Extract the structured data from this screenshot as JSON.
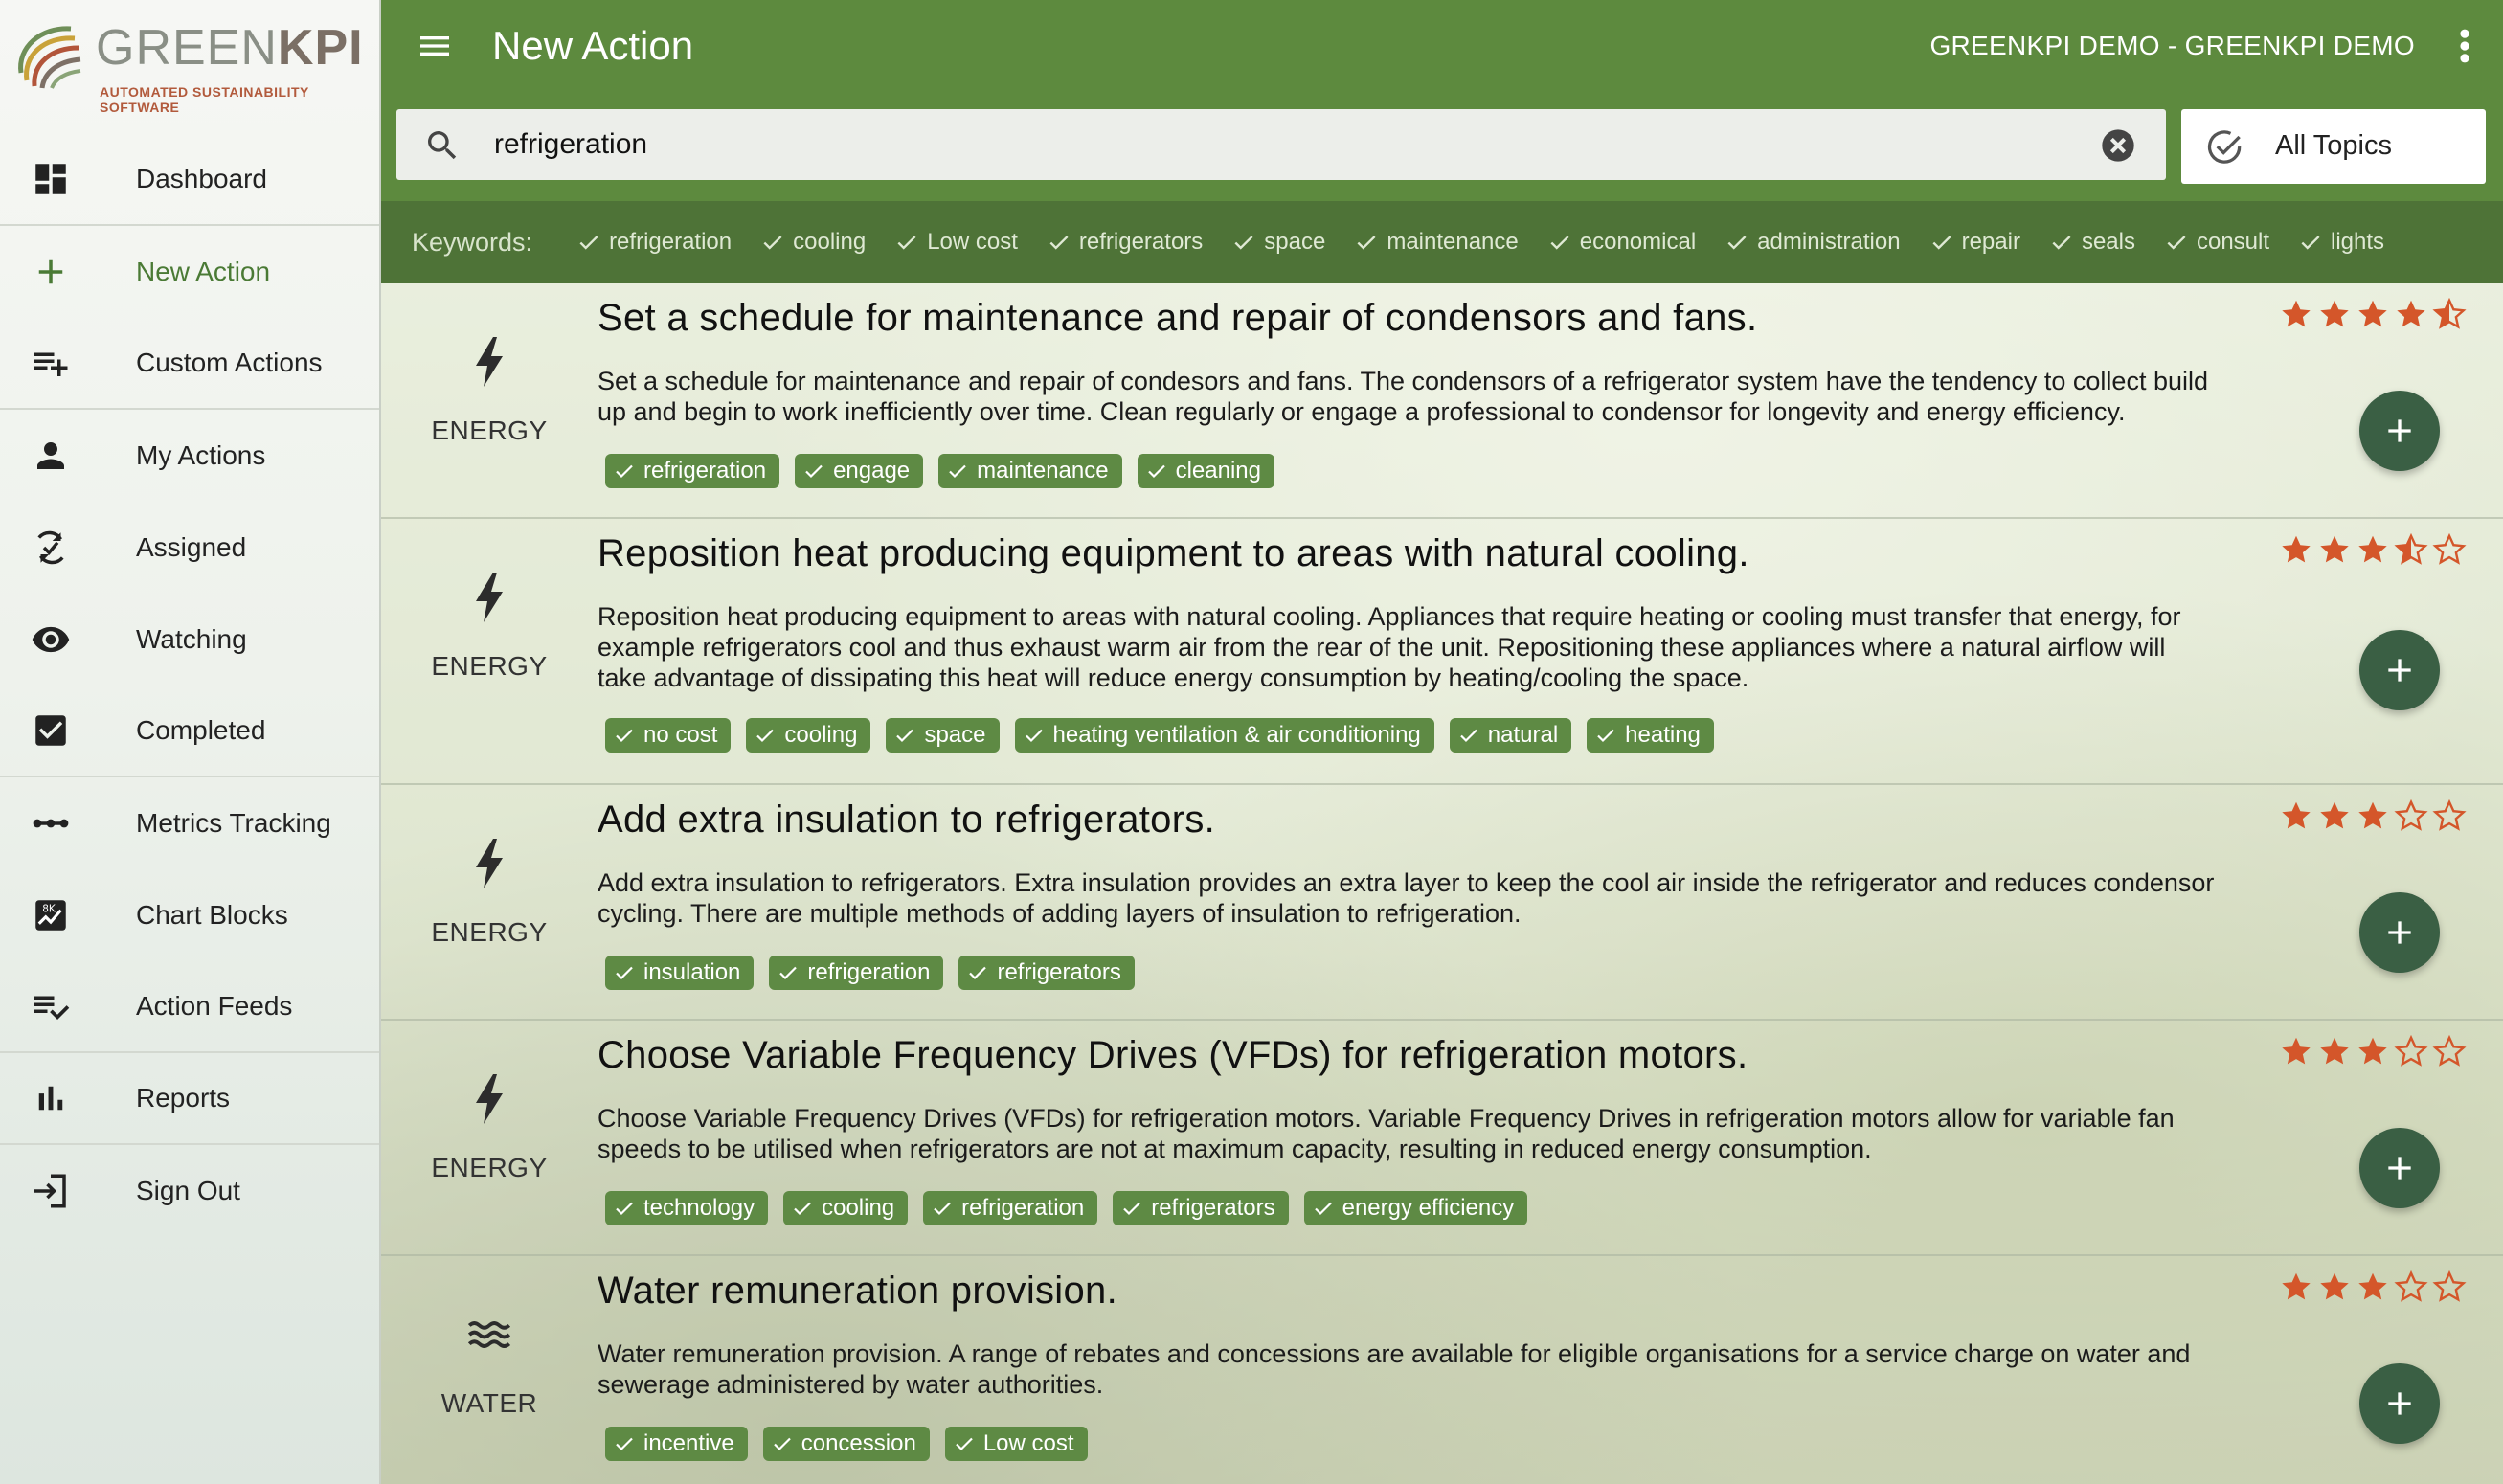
{
  "brand": {
    "name_light": "GREEN",
    "name_bold": "KPI",
    "tagline": "AUTOMATED SUSTAINABILITY SOFTWARE"
  },
  "sidebar": {
    "items": [
      {
        "label": "Dashboard",
        "icon": "dashboard-icon"
      },
      {
        "label": "New Action",
        "icon": "plus-icon",
        "active": true
      },
      {
        "label": "Custom Actions",
        "icon": "playlist-add-icon"
      },
      {
        "label": "My Actions",
        "icon": "person-icon"
      },
      {
        "label": "Assigned",
        "icon": "assigned-icon"
      },
      {
        "label": "Watching",
        "icon": "eye-icon"
      },
      {
        "label": "Completed",
        "icon": "checkbox-icon"
      },
      {
        "label": "Metrics Tracking",
        "icon": "timeline-icon"
      },
      {
        "label": "Chart Blocks",
        "icon": "chart-block-icon"
      },
      {
        "label": "Action Feeds",
        "icon": "playlist-check-icon"
      },
      {
        "label": "Reports",
        "icon": "bar-chart-icon"
      },
      {
        "label": "Sign Out",
        "icon": "sign-out-icon"
      }
    ]
  },
  "header": {
    "title": "New Action",
    "org": "GREENKPI DEMO - GREENKPI DEMO"
  },
  "search": {
    "value": "refrigeration",
    "topic_label": "All Topics"
  },
  "keywords": {
    "label": "Keywords:",
    "items": [
      "refrigeration",
      "cooling",
      "Low cost",
      "refrigerators",
      "space",
      "maintenance",
      "economical",
      "administration",
      "repair",
      "seals",
      "consult",
      "lights"
    ]
  },
  "colors": {
    "primary": "#5d8a3e",
    "keywords_bar": "#4e7337",
    "tag": "#5e8a44",
    "fab": "#3a5f44",
    "star": "#d4562a"
  },
  "actions": [
    {
      "category": "ENERGY",
      "category_icon": "bolt-icon",
      "title": "Set a schedule for maintenance and repair of condensors and fans.",
      "desc_lines": [
        "Set a schedule for maintenance and repair of condesors and fans. The condensors of a refrigerator system have the tendency to collect build",
        "up and begin to work inefficiently over time. Clean regularly or engage a professional to condensor for longevity and energy efficiency."
      ],
      "tags": [
        "refrigeration",
        "engage",
        "maintenance",
        "cleaning"
      ],
      "rating": 4.5
    },
    {
      "category": "ENERGY",
      "category_icon": "bolt-icon",
      "title": "Reposition heat producing equipment to areas with natural cooling.",
      "desc_lines": [
        "Reposition heat producing equipment to areas with natural cooling. Appliances that require heating or cooling must transfer that energy, for",
        "example refrigerators cool and thus exhaust warm air from the rear of the unit. Repositioning these appliances where a natural airflow will",
        "take advantage of dissipating this heat will reduce energy consumption by heating/cooling the space."
      ],
      "tags": [
        "no cost",
        "cooling",
        "space",
        "heating ventilation & air conditioning",
        "natural",
        "heating"
      ],
      "rating": 3.5
    },
    {
      "category": "ENERGY",
      "category_icon": "bolt-icon",
      "title": "Add extra insulation to refrigerators.",
      "desc_lines": [
        "Add extra insulation to refrigerators. Extra insulation provides an extra layer to keep the cool air inside the refrigerator and reduces condensor",
        "cycling. There are multiple methods of adding layers of insulation to refrigeration."
      ],
      "tags": [
        "insulation",
        "refrigeration",
        "refrigerators"
      ],
      "rating": 3
    },
    {
      "category": "ENERGY",
      "category_icon": "bolt-icon",
      "title": "Choose Variable Frequency Drives (VFDs) for refrigeration motors.",
      "desc_lines": [
        "Choose Variable Frequency Drives (VFDs) for refrigeration motors. Variable Frequency Drives in refrigeration motors allow for variable fan",
        "speeds to be utilised when refrigerators are not at maximum capacity, resulting in reduced energy consumption."
      ],
      "tags": [
        "technology",
        "cooling",
        "refrigeration",
        "refrigerators",
        "energy efficiency"
      ],
      "rating": 3
    },
    {
      "category": "WATER",
      "category_icon": "waves-icon",
      "title": "Water remuneration provision.",
      "desc_lines": [
        "Water remuneration provision. A range of rebates and concessions are available for eligible organisations for a service charge on water and",
        "sewerage administered by water authorities."
      ],
      "tags": [
        "incentive",
        "concession",
        "Low cost"
      ],
      "rating": 3
    }
  ]
}
